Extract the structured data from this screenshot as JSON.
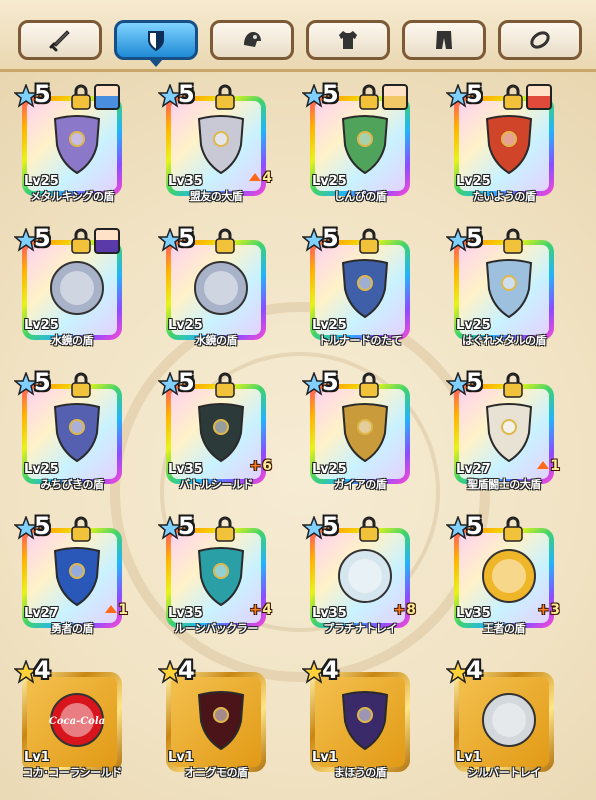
{
  "tabs": [
    {
      "icon": "sword-icon",
      "active": false
    },
    {
      "icon": "shield-icon",
      "active": true
    },
    {
      "icon": "helmet-icon",
      "active": false
    },
    {
      "icon": "shirt-icon",
      "active": false
    },
    {
      "icon": "pants-icon",
      "active": false
    },
    {
      "icon": "accessory-icon",
      "active": false
    }
  ],
  "items": [
    {
      "name": "メタルキングの盾",
      "level": "Lv25",
      "rarity": "5",
      "locked": true,
      "avatar": "character-blue",
      "bonus": "",
      "bonus_type": "",
      "frame": "rainbow",
      "art": "#8c78c8"
    },
    {
      "name": "盟友の大盾",
      "level": "Lv35",
      "rarity": "5",
      "locked": true,
      "avatar": "",
      "bonus": "4",
      "bonus_type": "up",
      "frame": "rainbow",
      "art": "#c9c9d6"
    },
    {
      "name": "しんぴの盾",
      "level": "Lv25",
      "rarity": "5",
      "locked": true,
      "avatar": "character-blonde",
      "bonus": "",
      "bonus_type": "",
      "frame": "rainbow",
      "art": "#4fa35a"
    },
    {
      "name": "たいようの盾",
      "level": "Lv25",
      "rarity": "5",
      "locked": true,
      "avatar": "character-red",
      "bonus": "",
      "bonus_type": "",
      "frame": "rainbow",
      "art": "#d0442a"
    },
    {
      "name": "水鏡の盾",
      "level": "Lv25",
      "rarity": "5",
      "locked": true,
      "avatar": "character-purple",
      "bonus": "",
      "bonus_type": "",
      "frame": "rainbow",
      "art": "#a8b2c8"
    },
    {
      "name": "水鏡の盾",
      "level": "Lv25",
      "rarity": "5",
      "locked": true,
      "avatar": "",
      "bonus": "",
      "bonus_type": "",
      "frame": "rainbow",
      "art": "#a8b2c8"
    },
    {
      "name": "トルナードのたて",
      "level": "Lv25",
      "rarity": "5",
      "locked": true,
      "avatar": "",
      "bonus": "",
      "bonus_type": "",
      "frame": "rainbow",
      "art": "#3f5fa8"
    },
    {
      "name": "はぐれメタルの盾",
      "level": "Lv25",
      "rarity": "5",
      "locked": true,
      "avatar": "",
      "bonus": "",
      "bonus_type": "",
      "frame": "rainbow",
      "art": "#9cc0de"
    },
    {
      "name": "みちびきの盾",
      "level": "Lv25",
      "rarity": "5",
      "locked": true,
      "avatar": "",
      "bonus": "",
      "bonus_type": "",
      "frame": "rainbow",
      "art": "#5560b0"
    },
    {
      "name": "バトルシールド",
      "level": "Lv35",
      "rarity": "5",
      "locked": true,
      "avatar": "",
      "bonus": "6",
      "bonus_type": "plus",
      "frame": "rainbow",
      "art": "#2c3a3a"
    },
    {
      "name": "ガイアの盾",
      "level": "Lv25",
      "rarity": "5",
      "locked": true,
      "avatar": "",
      "bonus": "",
      "bonus_type": "",
      "frame": "rainbow",
      "art": "#c99b3a"
    },
    {
      "name": "聖盾闘士の大盾",
      "level": "Lv27",
      "rarity": "5",
      "locked": true,
      "avatar": "",
      "bonus": "1",
      "bonus_type": "up",
      "frame": "rainbow",
      "art": "#e8e2d4"
    },
    {
      "name": "勇者の盾",
      "level": "Lv27",
      "rarity": "5",
      "locked": true,
      "avatar": "",
      "bonus": "1",
      "bonus_type": "up",
      "frame": "rainbow",
      "art": "#2a58b8"
    },
    {
      "name": "ルーンバックラー",
      "level": "Lv35",
      "rarity": "5",
      "locked": true,
      "avatar": "",
      "bonus": "4",
      "bonus_type": "plus",
      "frame": "rainbow",
      "art": "#2aa0a6"
    },
    {
      "name": "プラチナトレイ",
      "level": "Lv35",
      "rarity": "5",
      "locked": true,
      "avatar": "",
      "bonus": "8",
      "bonus_type": "plus",
      "frame": "rainbow",
      "art": "#d6e6ee"
    },
    {
      "name": "王者の盾",
      "level": "Lv35",
      "rarity": "5",
      "locked": true,
      "avatar": "",
      "bonus": "3",
      "bonus_type": "plus",
      "frame": "rainbow",
      "art": "#f0b62a"
    },
    {
      "name": "コカ･コーラシールド",
      "level": "Lv1",
      "rarity": "4",
      "locked": false,
      "avatar": "",
      "bonus": "",
      "bonus_type": "",
      "frame": "gold",
      "art": "#d8141c",
      "logo": "Coca-Cola"
    },
    {
      "name": "オニグモの盾",
      "level": "Lv1",
      "rarity": "4",
      "locked": false,
      "avatar": "",
      "bonus": "",
      "bonus_type": "",
      "frame": "gold",
      "art": "#4a1418"
    },
    {
      "name": "まほうの盾",
      "level": "Lv1",
      "rarity": "4",
      "locked": false,
      "avatar": "",
      "bonus": "",
      "bonus_type": "",
      "frame": "gold",
      "art": "#3a2a6a"
    },
    {
      "name": "シルバートレイ",
      "level": "Lv1",
      "rarity": "4",
      "locked": false,
      "avatar": "",
      "bonus": "",
      "bonus_type": "",
      "frame": "gold",
      "art": "#d2d8dc"
    }
  ],
  "colors": {
    "accent": "#1f8ad6",
    "gold": "#e29a16",
    "background": "#efe0bf"
  }
}
